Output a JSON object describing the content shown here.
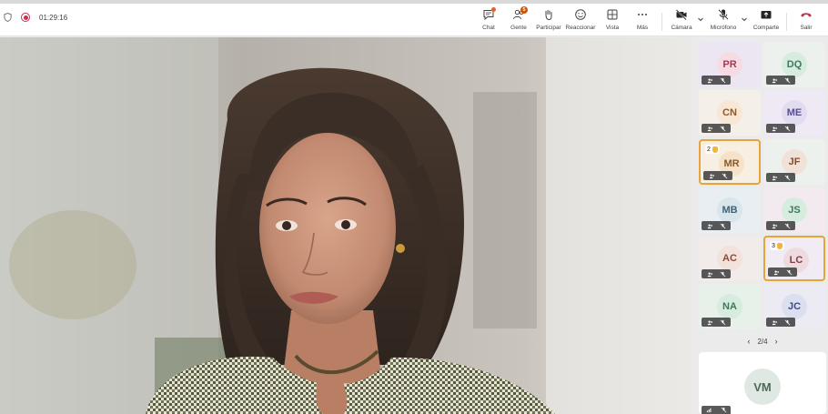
{
  "toolbar": {
    "timer": "01:29:16",
    "buttons": [
      {
        "key": "chat",
        "label": "Chat",
        "icon": "chat-icon"
      },
      {
        "key": "people",
        "label": "Gente",
        "icon": "people-icon",
        "badge": "5"
      },
      {
        "key": "raise",
        "label": "Participar",
        "icon": "raise-hand-icon"
      },
      {
        "key": "react",
        "label": "Reaccionar",
        "icon": "smile-icon"
      },
      {
        "key": "view",
        "label": "Vista",
        "icon": "grid-view-icon"
      },
      {
        "key": "more",
        "label": "Más",
        "icon": "more-icon"
      },
      {
        "key": "camera",
        "label": "Cámara",
        "icon": "camera-off-icon"
      },
      {
        "key": "mic",
        "label": "Micrófono",
        "icon": "mic-off-icon"
      },
      {
        "key": "share",
        "label": "Comparte",
        "icon": "share-icon"
      },
      {
        "key": "leave",
        "label": "Salir",
        "icon": "hangup-icon"
      }
    ]
  },
  "participants": [
    {
      "initials": "PR",
      "bg": "#ece6f3",
      "avbg": "#f7dbe3",
      "fg": "#a8384f"
    },
    {
      "initials": "DQ",
      "bg": "#ecf1ee",
      "avbg": "#d6ecdf",
      "fg": "#3e7a5a"
    },
    {
      "initials": "CN",
      "bg": "#f4efe9",
      "avbg": "#f8e7d4",
      "fg": "#8a5a2a"
    },
    {
      "initials": "ME",
      "bg": "#eee9f4",
      "avbg": "#e2dcf0",
      "fg": "#5b4b8a"
    },
    {
      "initials": "MR",
      "bg": "#f6efe2",
      "avbg": "#f6e2c8",
      "fg": "#8a5a2a",
      "hand": "2",
      "highlight": true
    },
    {
      "initials": "JF",
      "bg": "#ecf1ee",
      "avbg": "#f0e2d8",
      "fg": "#8a4a2a"
    },
    {
      "initials": "MB",
      "bg": "#e9eef3",
      "avbg": "#d8e6ec",
      "fg": "#3a6475"
    },
    {
      "initials": "JS",
      "bg": "#f2eaef",
      "avbg": "#d6ecdf",
      "fg": "#3e7a5a"
    },
    {
      "initials": "AC",
      "bg": "#f1ece9",
      "avbg": "#f1e2dc",
      "fg": "#8a4a3a"
    },
    {
      "initials": "LC",
      "bg": "#f1ecf3",
      "avbg": "#eddcdf",
      "fg": "#8a3a4a",
      "hand": "3",
      "highlight": true
    },
    {
      "initials": "NA",
      "bg": "#e8f0ea",
      "avbg": "#d6ecdf",
      "fg": "#3e7a5a"
    },
    {
      "initials": "JC",
      "bg": "#ecebf3",
      "avbg": "#dcdff0",
      "fg": "#3a4a8a"
    }
  ],
  "pager": {
    "text": "2/4"
  },
  "spotlight": {
    "initials": "VM"
  },
  "colors": {
    "accent": "#e8a33a",
    "leave": "#c4314b"
  }
}
